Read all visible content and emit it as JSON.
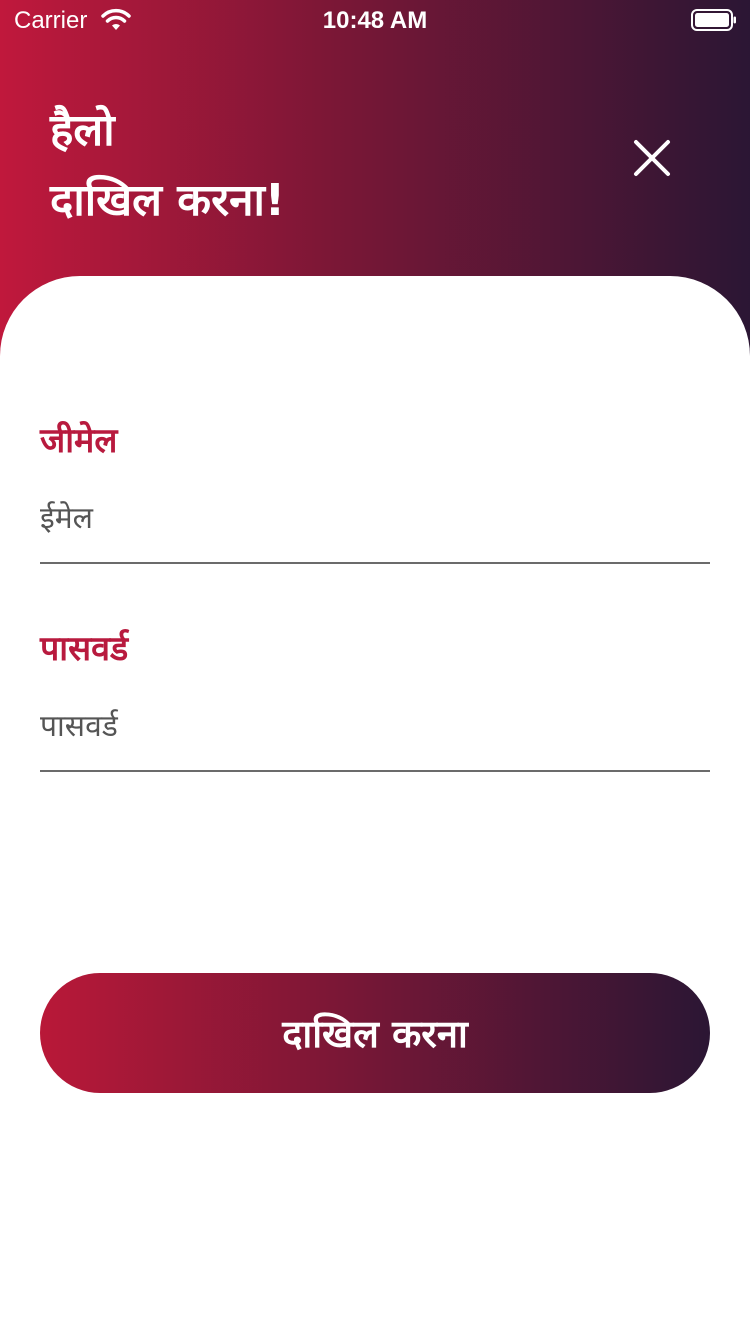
{
  "status_bar": {
    "carrier": "Carrier",
    "time": "10:48 AM",
    "wifi_icon": "wifi-icon",
    "battery_icon": "battery-full-icon"
  },
  "header": {
    "greeting_line1": "हैलो",
    "greeting_line2": "दाखिल करना!",
    "close_icon": "close-icon"
  },
  "form": {
    "email": {
      "label": "जीमेल",
      "placeholder": "ईमेल",
      "value": ""
    },
    "password": {
      "label": "पासवर्ड",
      "placeholder": "पासवर्ड",
      "value": ""
    },
    "submit_label": "दाखिल करना"
  },
  "colors": {
    "gradient_start": "#c0183c",
    "gradient_end": "#2b1634",
    "label_color": "#b81a3e"
  }
}
